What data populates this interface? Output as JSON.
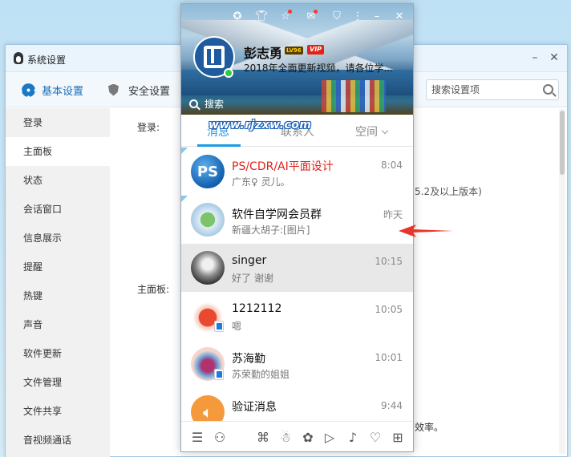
{
  "settings": {
    "title": "系统设置",
    "toolbar": {
      "basic_label": "基本设置",
      "security_label": "安全设置",
      "search_placeholder": "搜索设置项"
    },
    "sidebar": {
      "items": [
        {
          "label": "登录"
        },
        {
          "label": "主面板"
        },
        {
          "label": "状态"
        },
        {
          "label": "会话窗口"
        },
        {
          "label": "信息展示"
        },
        {
          "label": "提醒"
        },
        {
          "label": "热键"
        },
        {
          "label": "声音"
        },
        {
          "label": "软件更新"
        },
        {
          "label": "文件管理"
        },
        {
          "label": "文件共享"
        },
        {
          "label": "音视频通话"
        }
      ],
      "active_index": 1
    },
    "content": {
      "login_label": "登录:",
      "mainpanel_label": "主面板:",
      "version_text": "5.2及以上版本)",
      "efficiency_text": "效率。"
    }
  },
  "qq": {
    "profile": {
      "nickname": "彭志勇",
      "level_badge": "LV96",
      "vip_badge": "VIP",
      "signature": "2018年全面更新视频，请各位学...",
      "search_placeholder": "搜索"
    },
    "watermark": "www.rjzxw.com",
    "tabs": [
      {
        "label": "消息",
        "active": true
      },
      {
        "label": "联系人",
        "active": false
      },
      {
        "label": "空间",
        "active": false
      }
    ],
    "conversations": [
      {
        "name": "PS/CDR/AI平面设计",
        "message": "广东♀ 灵儿。",
        "time": "8:04",
        "name_color": "red",
        "avatar": "PS"
      },
      {
        "name": "软件自学网会员群",
        "message": "新疆大胡子:[图片]",
        "time": "昨天",
        "name_color": "normal",
        "avatar": ""
      },
      {
        "name": "singer",
        "message": "好了 谢谢",
        "time": "10:15",
        "name_color": "normal",
        "avatar": ""
      },
      {
        "name": "1212112",
        "message": "嗯",
        "time": "10:05",
        "name_color": "normal",
        "avatar": ""
      },
      {
        "name": "苏海勤",
        "message": "苏荣勤的姐姐",
        "time": "10:01",
        "name_color": "normal",
        "avatar": ""
      },
      {
        "name": "验证消息",
        "message": "",
        "time": "9:44",
        "name_color": "normal",
        "avatar": ""
      }
    ],
    "bottom_icons": [
      "menu-icon",
      "add-friend-icon",
      "game-icon",
      "penguin-icon",
      "flower-icon",
      "play-icon",
      "music-icon",
      "vip-icon",
      "apps-icon"
    ]
  },
  "colors": {
    "accent_blue": "#1a9be6",
    "name_red": "#e0221b",
    "arrow_red": "#e8352a"
  }
}
